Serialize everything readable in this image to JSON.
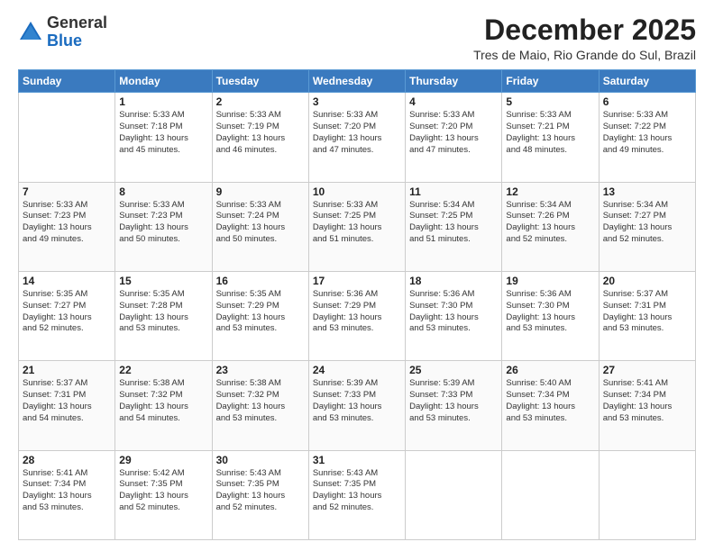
{
  "logo": {
    "general": "General",
    "blue": "Blue"
  },
  "header": {
    "month_title": "December 2025",
    "subtitle": "Tres de Maio, Rio Grande do Sul, Brazil"
  },
  "weekdays": [
    "Sunday",
    "Monday",
    "Tuesday",
    "Wednesday",
    "Thursday",
    "Friday",
    "Saturday"
  ],
  "weeks": [
    [
      {
        "day": "",
        "info": ""
      },
      {
        "day": "1",
        "info": "Sunrise: 5:33 AM\nSunset: 7:18 PM\nDaylight: 13 hours\nand 45 minutes."
      },
      {
        "day": "2",
        "info": "Sunrise: 5:33 AM\nSunset: 7:19 PM\nDaylight: 13 hours\nand 46 minutes."
      },
      {
        "day": "3",
        "info": "Sunrise: 5:33 AM\nSunset: 7:20 PM\nDaylight: 13 hours\nand 47 minutes."
      },
      {
        "day": "4",
        "info": "Sunrise: 5:33 AM\nSunset: 7:20 PM\nDaylight: 13 hours\nand 47 minutes."
      },
      {
        "day": "5",
        "info": "Sunrise: 5:33 AM\nSunset: 7:21 PM\nDaylight: 13 hours\nand 48 minutes."
      },
      {
        "day": "6",
        "info": "Sunrise: 5:33 AM\nSunset: 7:22 PM\nDaylight: 13 hours\nand 49 minutes."
      }
    ],
    [
      {
        "day": "7",
        "info": "Sunrise: 5:33 AM\nSunset: 7:23 PM\nDaylight: 13 hours\nand 49 minutes."
      },
      {
        "day": "8",
        "info": "Sunrise: 5:33 AM\nSunset: 7:23 PM\nDaylight: 13 hours\nand 50 minutes."
      },
      {
        "day": "9",
        "info": "Sunrise: 5:33 AM\nSunset: 7:24 PM\nDaylight: 13 hours\nand 50 minutes."
      },
      {
        "day": "10",
        "info": "Sunrise: 5:33 AM\nSunset: 7:25 PM\nDaylight: 13 hours\nand 51 minutes."
      },
      {
        "day": "11",
        "info": "Sunrise: 5:34 AM\nSunset: 7:25 PM\nDaylight: 13 hours\nand 51 minutes."
      },
      {
        "day": "12",
        "info": "Sunrise: 5:34 AM\nSunset: 7:26 PM\nDaylight: 13 hours\nand 52 minutes."
      },
      {
        "day": "13",
        "info": "Sunrise: 5:34 AM\nSunset: 7:27 PM\nDaylight: 13 hours\nand 52 minutes."
      }
    ],
    [
      {
        "day": "14",
        "info": "Sunrise: 5:35 AM\nSunset: 7:27 PM\nDaylight: 13 hours\nand 52 minutes."
      },
      {
        "day": "15",
        "info": "Sunrise: 5:35 AM\nSunset: 7:28 PM\nDaylight: 13 hours\nand 53 minutes."
      },
      {
        "day": "16",
        "info": "Sunrise: 5:35 AM\nSunset: 7:29 PM\nDaylight: 13 hours\nand 53 minutes."
      },
      {
        "day": "17",
        "info": "Sunrise: 5:36 AM\nSunset: 7:29 PM\nDaylight: 13 hours\nand 53 minutes."
      },
      {
        "day": "18",
        "info": "Sunrise: 5:36 AM\nSunset: 7:30 PM\nDaylight: 13 hours\nand 53 minutes."
      },
      {
        "day": "19",
        "info": "Sunrise: 5:36 AM\nSunset: 7:30 PM\nDaylight: 13 hours\nand 53 minutes."
      },
      {
        "day": "20",
        "info": "Sunrise: 5:37 AM\nSunset: 7:31 PM\nDaylight: 13 hours\nand 53 minutes."
      }
    ],
    [
      {
        "day": "21",
        "info": "Sunrise: 5:37 AM\nSunset: 7:31 PM\nDaylight: 13 hours\nand 54 minutes."
      },
      {
        "day": "22",
        "info": "Sunrise: 5:38 AM\nSunset: 7:32 PM\nDaylight: 13 hours\nand 54 minutes."
      },
      {
        "day": "23",
        "info": "Sunrise: 5:38 AM\nSunset: 7:32 PM\nDaylight: 13 hours\nand 53 minutes."
      },
      {
        "day": "24",
        "info": "Sunrise: 5:39 AM\nSunset: 7:33 PM\nDaylight: 13 hours\nand 53 minutes."
      },
      {
        "day": "25",
        "info": "Sunrise: 5:39 AM\nSunset: 7:33 PM\nDaylight: 13 hours\nand 53 minutes."
      },
      {
        "day": "26",
        "info": "Sunrise: 5:40 AM\nSunset: 7:34 PM\nDaylight: 13 hours\nand 53 minutes."
      },
      {
        "day": "27",
        "info": "Sunrise: 5:41 AM\nSunset: 7:34 PM\nDaylight: 13 hours\nand 53 minutes."
      }
    ],
    [
      {
        "day": "28",
        "info": "Sunrise: 5:41 AM\nSunset: 7:34 PM\nDaylight: 13 hours\nand 53 minutes."
      },
      {
        "day": "29",
        "info": "Sunrise: 5:42 AM\nSunset: 7:35 PM\nDaylight: 13 hours\nand 52 minutes."
      },
      {
        "day": "30",
        "info": "Sunrise: 5:43 AM\nSunset: 7:35 PM\nDaylight: 13 hours\nand 52 minutes."
      },
      {
        "day": "31",
        "info": "Sunrise: 5:43 AM\nSunset: 7:35 PM\nDaylight: 13 hours\nand 52 minutes."
      },
      {
        "day": "",
        "info": ""
      },
      {
        "day": "",
        "info": ""
      },
      {
        "day": "",
        "info": ""
      }
    ]
  ]
}
